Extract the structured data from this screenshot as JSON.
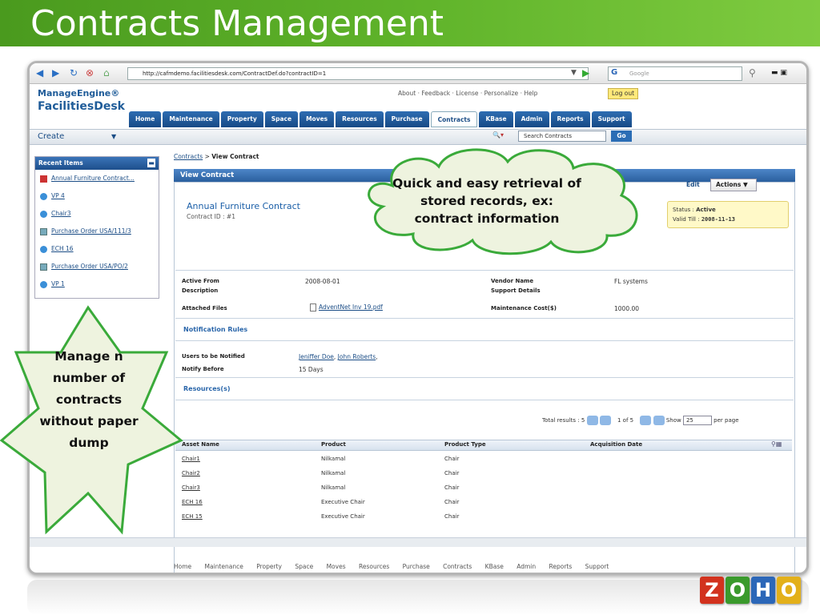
{
  "slide": {
    "title": "Contracts Management"
  },
  "browser": {
    "url": "http://cafmdemo.facilitiesdesk.com/ContractDef.do?contractID=1",
    "search_placeholder": "Google"
  },
  "app": {
    "logo_line1": "ManageEngine®",
    "logo_line2": "FacilitiesDesk",
    "top_links": [
      "About",
      "Feedback",
      "License",
      "Personalize",
      "Help"
    ],
    "logout_label": "Log out",
    "tabs": [
      {
        "label": "Home"
      },
      {
        "label": "Maintenance"
      },
      {
        "label": "Property"
      },
      {
        "label": "Space"
      },
      {
        "label": "Moves"
      },
      {
        "label": "Resources"
      },
      {
        "label": "Purchase"
      },
      {
        "label": "Contracts"
      },
      {
        "label": "KBase"
      },
      {
        "label": "Admin"
      },
      {
        "label": "Reports"
      },
      {
        "label": "Support"
      }
    ],
    "active_tab": "Contracts",
    "create_label": "Create",
    "search_value": "Search Contracts",
    "go_label": "Go"
  },
  "sidebar": {
    "title": "Recent Items",
    "items": [
      {
        "label": "Annual Furniture Contract..."
      },
      {
        "label": "VP 4"
      },
      {
        "label": "Chair3"
      },
      {
        "label": "Purchase Order USA/111/3"
      },
      {
        "label": "ECH 16"
      },
      {
        "label": "Purchase Order USA/PO/2"
      },
      {
        "label": "VP 1"
      }
    ]
  },
  "contract": {
    "breadcrumb_root": "Contracts",
    "breadcrumb_sep": ">",
    "breadcrumb_current": "View Contract",
    "panel_title": "View Contract",
    "edit_label": "Edit",
    "actions_label": "Actions",
    "name": "Annual Furniture Contract",
    "id_text": "Contract ID : #1",
    "status_label": "Status :",
    "status_value": "Active",
    "valid_label": "Valid Till :",
    "valid_value": "2008-11-13",
    "active_from_label": "Active From",
    "active_from_value": "2008-08-01",
    "description_label": "Description",
    "vendor_label": "Vendor Name",
    "vendor_value": "FL systems",
    "support_label": "Support Details",
    "attached_label": "Attached Files",
    "attached_value": "AdventNet Inv 19.pdf",
    "maint_label": "Maintenance Cost($)",
    "maint_value": "1000.00",
    "notif_heading": "Notification Rules",
    "notify_users_label": "Users to be Notified",
    "notify_user1": "Jeniffer Doe",
    "notify_user2": "John Roberts",
    "notify_before_label": "Notify Before",
    "notify_before_value": "15 Days",
    "resources_heading": "Resources(s)"
  },
  "paging": {
    "total_text": "Total results : 5",
    "range_text": "1 of 5",
    "show_label": "Show",
    "per_page_value": "25",
    "per_page_label": "per page"
  },
  "table": {
    "columns": [
      "Asset Name",
      "Product",
      "Product Type",
      "Acquisition Date"
    ],
    "rows": [
      [
        "Chair1",
        "Nilkamal",
        "Chair",
        ""
      ],
      [
        "Chair2",
        "Nilkamal",
        "Chair",
        ""
      ],
      [
        "Chair3",
        "Nilkamal",
        "Chair",
        ""
      ],
      [
        "ECH 16",
        "Executive Chair",
        "Chair",
        ""
      ],
      [
        "ECH 15",
        "Executive Chair",
        "Chair",
        ""
      ]
    ]
  },
  "footer_links": "Home Maintenance Property Space Moves Resources Purchase Contracts KBase Admin Reports Support",
  "callouts": {
    "cloud": "Quick and easy retrieval of stored records, ex: contract information",
    "star": "Manage n number of contracts without paper dump"
  },
  "brand": {
    "letters": [
      "Z",
      "O",
      "H",
      "O"
    ],
    "colors": [
      "#d2321e",
      "#3a9a2c",
      "#2c67b8",
      "#e3b01a"
    ],
    "accent": "#5fb32a"
  }
}
